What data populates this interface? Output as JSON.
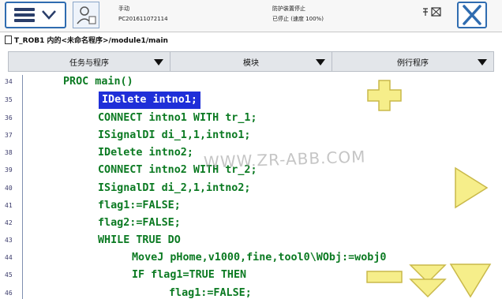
{
  "topbar": {
    "status_left_line1": "手动",
    "status_left_line2": "PC201611072114",
    "status_right_line1": "防护装置停止",
    "status_right_line2": "已停止 (速度 100%)"
  },
  "path": {
    "text": "T_ROB1 内的<未命名程序>/module1/main"
  },
  "tabs": [
    {
      "label": "任务与程序"
    },
    {
      "label": "模块"
    },
    {
      "label": "例行程序"
    }
  ],
  "code_lines": [
    {
      "num": "34",
      "text": "PROC main()",
      "selected": false
    },
    {
      "num": "35",
      "text": "IDelete intno1;",
      "selected": true
    },
    {
      "num": "36",
      "text": "CONNECT intno1 WITH tr_1;",
      "selected": false
    },
    {
      "num": "37",
      "text": "ISignalDI di_1,1,intno1;",
      "selected": false
    },
    {
      "num": "38",
      "text": "IDelete intno2;",
      "selected": false
    },
    {
      "num": "39",
      "text": "CONNECT intno2 WITH tr_2;",
      "selected": false
    },
    {
      "num": "40",
      "text": "ISignalDI di_2,1,intno2;",
      "selected": false
    },
    {
      "num": "41",
      "text": "flag1:=FALSE;",
      "selected": false
    },
    {
      "num": "42",
      "text": "flag2:=FALSE;",
      "selected": false
    },
    {
      "num": "43",
      "text": "WHILE TRUE DO",
      "selected": false
    },
    {
      "num": "44",
      "text": "MoveJ pHome,v1000,fine,tool0\\WObj:=wobj0",
      "selected": false
    },
    {
      "num": "45",
      "text": "IF flag1=TRUE THEN",
      "selected": false
    },
    {
      "num": "46",
      "text": "flag1:=FALSE;",
      "selected": false
    }
  ],
  "watermark": "WWW.ZR-ABB.COM",
  "icons": {
    "menu": "hamburger-menu-icon",
    "close": "close-icon",
    "zoom_in": "plus-icon",
    "zoom_out": "minus-icon",
    "scroll_right": "triangle-right-icon",
    "scroll_down": "triangle-down-icon"
  },
  "colors": {
    "code_text": "#0b7a22",
    "selection_bg": "#1f2fd8",
    "control_yellow": "#f6ee8a"
  }
}
